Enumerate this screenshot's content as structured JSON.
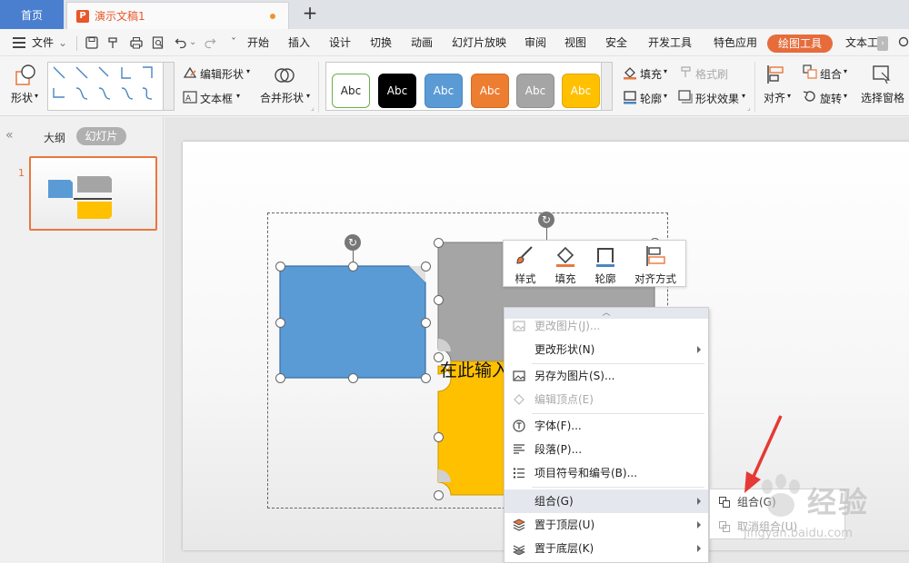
{
  "tabs": {
    "home": "首页",
    "document": "演示文稿1",
    "ppt_badge": "P",
    "new_tab": "+"
  },
  "menu": {
    "file": "文件",
    "items": [
      "开始",
      "插入",
      "设计",
      "切换",
      "动画",
      "幻灯片放映",
      "审阅",
      "视图",
      "安全",
      "开发工具",
      "特色应用"
    ],
    "active": "绘图工具",
    "text_tool": "文本工"
  },
  "ribbon": {
    "shape": "形状",
    "edit_shape": "编辑形状",
    "textbox": "文本框",
    "merge_shapes": "合并形状",
    "style_samples": [
      {
        "label": "Abc",
        "bg": "#ffffff",
        "fg": "#222222",
        "border": "#6ab04c"
      },
      {
        "label": "Abc",
        "bg": "#000000",
        "fg": "#ffffff",
        "border": "#000000"
      },
      {
        "label": "Abc",
        "bg": "#5b9bd5",
        "fg": "#ffffff",
        "border": "#4a86c0"
      },
      {
        "label": "Abc",
        "bg": "#ed7d31",
        "fg": "#ffffff",
        "border": "#d46a22"
      },
      {
        "label": "Abc",
        "bg": "#a5a5a5",
        "fg": "#ffffff",
        "border": "#909090"
      },
      {
        "label": "Abc",
        "bg": "#ffc000",
        "fg": "#ffffff",
        "border": "#e0a800"
      }
    ],
    "fill": "填充",
    "format_brush": "格式刷",
    "outline": "轮廓",
    "shape_effects": "形状效果",
    "align": "对齐",
    "group": "组合",
    "rotate": "旋转",
    "selection_pane": "选择窗格"
  },
  "left_panel": {
    "outline": "大纲",
    "slides": "幻灯片",
    "slide_number": "1"
  },
  "slide": {
    "placeholder": "在此输入"
  },
  "mini_toolbar": {
    "style": "样式",
    "fill": "填充",
    "outline": "轮廓",
    "align": "对齐方式"
  },
  "context_menu": {
    "items": [
      {
        "label": "更改图片(J)...",
        "disabled": true,
        "icon": "change-picture-icon"
      },
      {
        "label": "更改形状(N)",
        "disabled": false,
        "icon": "",
        "submenu": true
      },
      {
        "label": "另存为图片(S)...",
        "disabled": false,
        "icon": "save-as-picture-icon"
      },
      {
        "label": "编辑顶点(E)",
        "disabled": true,
        "icon": "edit-points-icon"
      },
      {
        "label": "字体(F)...",
        "disabled": false,
        "icon": "font-icon"
      },
      {
        "label": "段落(P)...",
        "disabled": false,
        "icon": "paragraph-icon"
      },
      {
        "label": "项目符号和编号(B)...",
        "disabled": false,
        "icon": "bullets-icon"
      },
      {
        "label": "组合(G)",
        "disabled": false,
        "icon": "",
        "submenu": true,
        "hover": true
      },
      {
        "label": "置于顶层(U)",
        "disabled": false,
        "icon": "bring-to-front-icon",
        "submenu": true
      },
      {
        "label": "置于底层(K)",
        "disabled": false,
        "icon": "send-to-back-icon",
        "submenu": true
      }
    ],
    "submenu": {
      "group": "组合(G)",
      "ungroup": "取消组合(U)"
    }
  },
  "watermark": {
    "text": "经验",
    "url": "jingyan.baidu.com"
  },
  "colors": {
    "accent": "#e66c3c",
    "home_tab": "#4a7fd0",
    "blue_shape": "#5b9bd5",
    "gray_shape": "#a5a5a5",
    "yellow_shape": "#ffc000",
    "arrow": "#e53935"
  }
}
